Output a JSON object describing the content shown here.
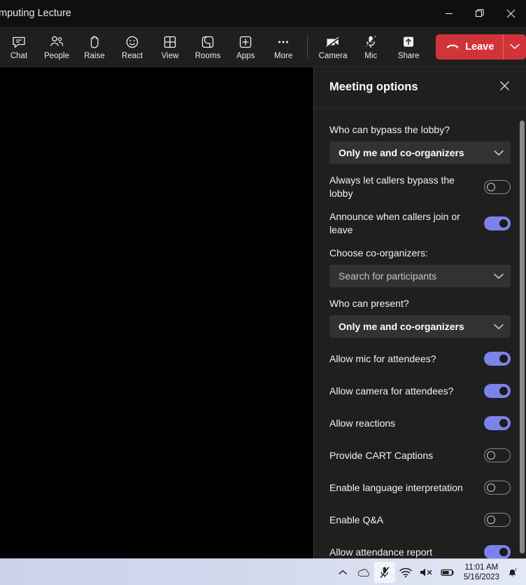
{
  "window": {
    "title": "mputing Lecture",
    "controls": [
      {
        "name": "minimize-button",
        "icon": "minimize-icon"
      },
      {
        "name": "restore-button",
        "icon": "restore-icon"
      },
      {
        "name": "close-button",
        "icon": "close-icon"
      }
    ]
  },
  "toolbar": {
    "items": [
      {
        "label": "Chat",
        "icon": "chat-icon"
      },
      {
        "label": "People",
        "icon": "people-icon"
      },
      {
        "label": "Raise",
        "icon": "raise-hand-icon"
      },
      {
        "label": "React",
        "icon": "react-smiley-icon"
      },
      {
        "label": "View",
        "icon": "view-grid-icon"
      },
      {
        "label": "Rooms",
        "icon": "breakout-rooms-icon"
      },
      {
        "label": "Apps",
        "icon": "apps-plus-icon"
      },
      {
        "label": "More",
        "icon": "more-ellipsis-icon"
      }
    ],
    "media": [
      {
        "label": "Camera",
        "icon": "camera-off-icon"
      },
      {
        "label": "Mic",
        "icon": "mic-off-icon"
      },
      {
        "label": "Share",
        "icon": "share-screen-icon"
      }
    ],
    "leave": {
      "label": "Leave",
      "icon": "hangup-icon",
      "caret_icon": "chevron-down-icon",
      "color": "#d13438"
    }
  },
  "panel": {
    "title": "Meeting options",
    "close_icon": "close-icon",
    "fields": [
      {
        "type": "dropdown",
        "label": "Who can bypass the lobby?",
        "value": "Only me and co-organizers",
        "placeholder": false
      },
      {
        "type": "toggle",
        "label": "Always let callers bypass the lobby",
        "state": "off"
      },
      {
        "type": "toggle",
        "label": "Announce when callers join or leave",
        "state": "on"
      },
      {
        "type": "dropdown",
        "label": "Choose co-organizers:",
        "value": "Search for participants",
        "placeholder": true
      },
      {
        "type": "dropdown",
        "label": "Who can present?",
        "value": "Only me and co-organizers",
        "placeholder": false
      },
      {
        "type": "toggle",
        "label": "Allow mic for attendees?",
        "state": "on"
      },
      {
        "type": "toggle",
        "label": "Allow camera for attendees?",
        "state": "on"
      },
      {
        "type": "toggle",
        "label": "Allow reactions",
        "state": "on"
      },
      {
        "type": "toggle",
        "label": "Provide CART Captions",
        "state": "off"
      },
      {
        "type": "toggle",
        "label": "Enable language interpretation",
        "state": "off"
      },
      {
        "type": "toggle",
        "label": "Enable Q&A",
        "state": "off"
      },
      {
        "type": "toggle",
        "label": "Allow attendance report",
        "state": "on"
      }
    ],
    "accent_on_color": "#7b83eb"
  },
  "taskbar": {
    "tray_icons": [
      {
        "name": "show-hidden-icons-chevron-icon"
      },
      {
        "name": "onedrive-cloud-icon"
      },
      {
        "name": "microphone-muted-icon"
      },
      {
        "name": "wifi-icon"
      },
      {
        "name": "volume-muted-icon"
      },
      {
        "name": "battery-icon"
      }
    ],
    "time": "11:01 AM",
    "date": "5/16/2023",
    "notification_icon": "notification-bell-quiet-icon"
  }
}
